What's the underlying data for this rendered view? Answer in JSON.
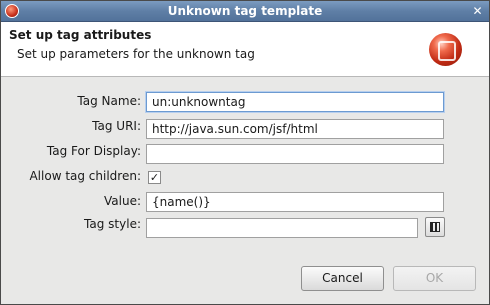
{
  "window": {
    "title": "Unknown tag template"
  },
  "banner": {
    "heading": "Set up tag attributes",
    "description": "Set up parameters for the unknown tag"
  },
  "form": {
    "tag_name": {
      "label": "Tag Name:",
      "value": "un:unknowntag"
    },
    "tag_uri": {
      "label": "Tag URI:",
      "value": "http://java.sun.com/jsf/html"
    },
    "tag_for_display": {
      "label": "Tag For Display:",
      "value": ""
    },
    "allow_children": {
      "label": "Allow tag children:",
      "checked": true,
      "mark": "✓"
    },
    "value": {
      "label": "Value:",
      "value": "{name()}"
    },
    "tag_style": {
      "label": "Tag style:",
      "value": ""
    }
  },
  "buttons": {
    "cancel": "Cancel",
    "ok": "OK"
  },
  "colors": {
    "titlebar": "#5f7fa6",
    "focus_border": "#6c9ad1"
  },
  "icons": {
    "app": "app-logo-icon",
    "close": "close-icon",
    "banner": "template-wizard-icon",
    "style_picker": "style-grid-icon"
  }
}
